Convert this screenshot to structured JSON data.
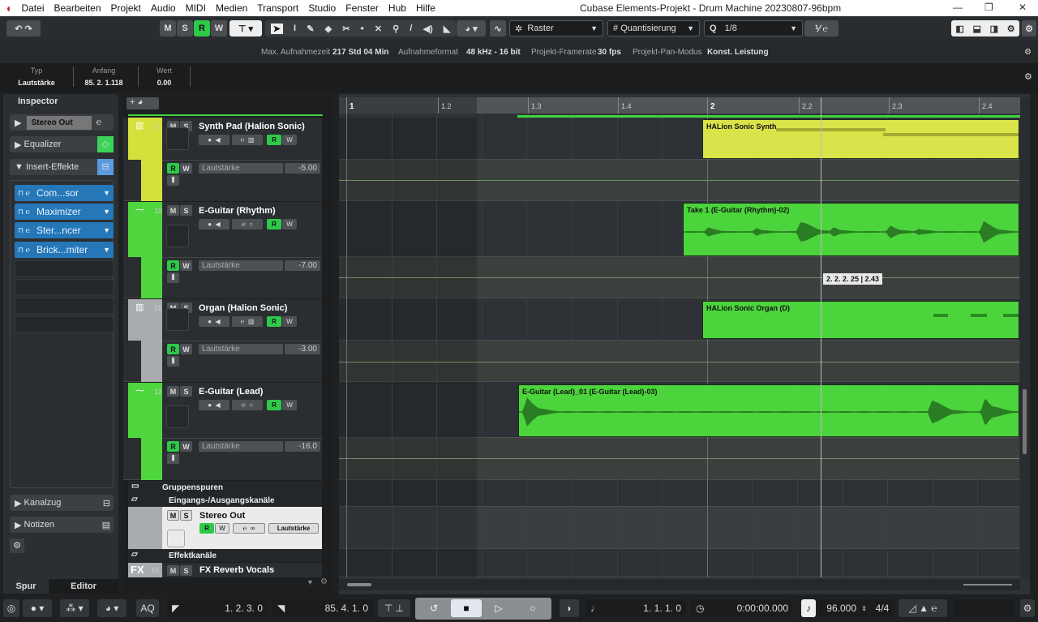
{
  "menu": {
    "items": [
      "Datei",
      "Bearbeiten",
      "Projekt",
      "Audio",
      "MIDI",
      "Medien",
      "Transport",
      "Studio",
      "Fenster",
      "Hub",
      "Hilfe"
    ],
    "title": "Cubase Elements-Projekt - Drum Machine 20230807-96bpm"
  },
  "toolbar": {
    "m": "M",
    "s": "S",
    "r": "R",
    "w": "W",
    "raster": "Raster",
    "quant": "Quantisierung",
    "q": "Q",
    "quant_value": "1/8"
  },
  "infoline": {
    "rec_time_label": "Max. Aufnahmezeit",
    "rec_time": "217 Std 04 Min",
    "format_label": "Aufnahmeformat",
    "format": "48 kHz - 16 bit",
    "framerate_label": "Projekt-Framerate",
    "framerate": "30 fps",
    "pan_label": "Projekt-Pan-Modus",
    "pan": "Konst. Leistung"
  },
  "infopanel": {
    "type_label": "Typ",
    "type": "Lautstärke",
    "start_label": "Anfang",
    "start": "85. 2. 1.118",
    "value_label": "Wert",
    "value": "0.00"
  },
  "inspector": {
    "tab": "Inspector",
    "channel": "Stereo Out",
    "equalizer": "Equalizer",
    "inserts": "Insert-Effekte",
    "plugins": [
      "Com...sor",
      "Maximizer",
      "Ster...ncer",
      "Brick...miter"
    ],
    "kanalzug": "Kanalzug",
    "notizen": "Notizen",
    "tab_spur": "Spur",
    "tab_editor": "Editor"
  },
  "tracks": [
    {
      "num": "9",
      "name": "Synth Pad (Halion Sonic)",
      "param": "Lautstärke",
      "value": "-5.00",
      "color": "#d4e03c",
      "event": "HALion Sonic Synth"
    },
    {
      "num": "10",
      "name": "E-Guitar (Rhythm)",
      "param": "Lautstärke",
      "value": "-7.00",
      "color": "#4fd63e",
      "event": "Take 1 (E-Guitar (Rhythm)-02)"
    },
    {
      "num": "11",
      "name": "Organ (Halion Sonic)",
      "param": "Lautstärke",
      "value": "-3.00",
      "color": "#a9acae",
      "event": "HALion Sonic Organ (D)"
    },
    {
      "num": "12",
      "name": "E-Guitar (Lead)",
      "param": "Lautstärke",
      "value": "-16.0",
      "color": "#4fd63e",
      "event": "E-Guitar (Lead)_01 (E-Guitar (Lead)-03)"
    }
  ],
  "folders": {
    "group": "Gruppenspuren",
    "io": "Eingangs-/Ausgangskanäle",
    "fx": "Effektkanäle"
  },
  "stereo_out": {
    "name": "Stereo Out",
    "param": "Lautstärke"
  },
  "fx_track": {
    "label": "FX",
    "num": "16",
    "name": "FX Reverb Vocals"
  },
  "ruler": [
    "1",
    "1.2",
    "1.3",
    "1.4",
    "2",
    "2.2",
    "2.3",
    "2.4"
  ],
  "tooltip": "2. 2. 2. 25 | 2.43",
  "transport": {
    "aq": "AQ",
    "left_locator": "1. 2. 3.   0",
    "right_locator": "85. 4. 1.   0",
    "position": "1. 1. 1.   0",
    "time": "0:00:00.000",
    "tempo": "96.000",
    "signature": "4/4"
  }
}
